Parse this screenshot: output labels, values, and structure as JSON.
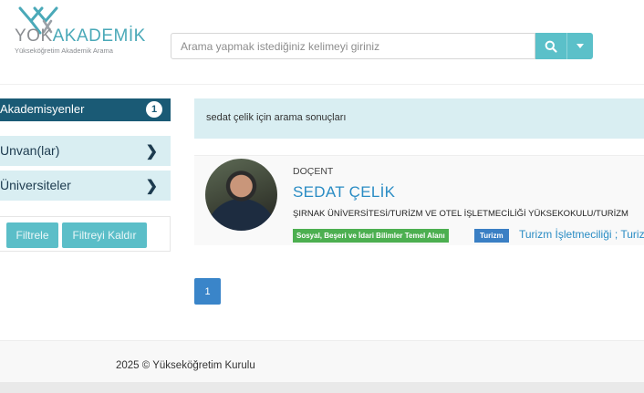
{
  "header": {
    "logo_yok": "YOK",
    "logo_akademik": "AKADEMİK",
    "logo_subtitle": "Yükseköğretim Akademik Arama",
    "search_placeholder": "Arama yapmak istediğiniz kelimeyi giriniz",
    "search_icon": "search-icon",
    "dropdown_icon": "caret-down-icon"
  },
  "sidebar": {
    "active_item": {
      "label": "Akademisyenler",
      "count": "1"
    },
    "items": [
      {
        "label": "Unvan(lar)"
      },
      {
        "label": "Üniversiteler"
      }
    ],
    "filter_button": "Filtrele",
    "clear_filter_button": "Filtreyi Kaldır"
  },
  "results": {
    "banner": "sedat çelik için arama sonuçları",
    "items": [
      {
        "title": "DOÇENT",
        "name": "SEDAT ÇELİK",
        "affiliation": "ŞIRNAK ÜNİVERSİTESİ/TURİZM VE OTEL İŞLETMECİLİĞİ YÜKSEKOKULU/TURİZM",
        "tag_field": "Sosyal, Beşeri ve İdari Bilimler Temel Alanı",
        "tag_discipline": "Turizm",
        "keywords": "Turizm İşletmeciliği ; Turizm"
      }
    ]
  },
  "pagination": {
    "current_page": "1"
  },
  "footer": {
    "copyright": "2025 © Yükseköğretim Kurulu"
  },
  "colors": {
    "accent": "#5bc0c9",
    "sidebar_active": "#1a5a75",
    "link": "#2a8cc4",
    "tag_green": "#4caf50",
    "tag_blue": "#3a7fc4"
  }
}
